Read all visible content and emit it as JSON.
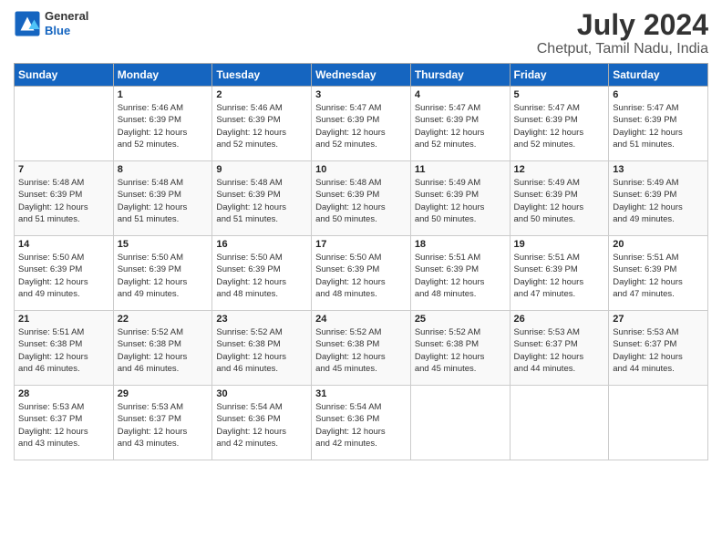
{
  "logo": {
    "line1": "General",
    "line2": "Blue"
  },
  "title": "July 2024",
  "subtitle": "Chetput, Tamil Nadu, India",
  "days_header": [
    "Sunday",
    "Monday",
    "Tuesday",
    "Wednesday",
    "Thursday",
    "Friday",
    "Saturday"
  ],
  "weeks": [
    [
      {
        "day": "",
        "info": ""
      },
      {
        "day": "1",
        "info": "Sunrise: 5:46 AM\nSunset: 6:39 PM\nDaylight: 12 hours\nand 52 minutes."
      },
      {
        "day": "2",
        "info": "Sunrise: 5:46 AM\nSunset: 6:39 PM\nDaylight: 12 hours\nand 52 minutes."
      },
      {
        "day": "3",
        "info": "Sunrise: 5:47 AM\nSunset: 6:39 PM\nDaylight: 12 hours\nand 52 minutes."
      },
      {
        "day": "4",
        "info": "Sunrise: 5:47 AM\nSunset: 6:39 PM\nDaylight: 12 hours\nand 52 minutes."
      },
      {
        "day": "5",
        "info": "Sunrise: 5:47 AM\nSunset: 6:39 PM\nDaylight: 12 hours\nand 52 minutes."
      },
      {
        "day": "6",
        "info": "Sunrise: 5:47 AM\nSunset: 6:39 PM\nDaylight: 12 hours\nand 51 minutes."
      }
    ],
    [
      {
        "day": "7",
        "info": "Sunrise: 5:48 AM\nSunset: 6:39 PM\nDaylight: 12 hours\nand 51 minutes."
      },
      {
        "day": "8",
        "info": "Sunrise: 5:48 AM\nSunset: 6:39 PM\nDaylight: 12 hours\nand 51 minutes."
      },
      {
        "day": "9",
        "info": "Sunrise: 5:48 AM\nSunset: 6:39 PM\nDaylight: 12 hours\nand 51 minutes."
      },
      {
        "day": "10",
        "info": "Sunrise: 5:48 AM\nSunset: 6:39 PM\nDaylight: 12 hours\nand 50 minutes."
      },
      {
        "day": "11",
        "info": "Sunrise: 5:49 AM\nSunset: 6:39 PM\nDaylight: 12 hours\nand 50 minutes."
      },
      {
        "day": "12",
        "info": "Sunrise: 5:49 AM\nSunset: 6:39 PM\nDaylight: 12 hours\nand 50 minutes."
      },
      {
        "day": "13",
        "info": "Sunrise: 5:49 AM\nSunset: 6:39 PM\nDaylight: 12 hours\nand 49 minutes."
      }
    ],
    [
      {
        "day": "14",
        "info": "Sunrise: 5:50 AM\nSunset: 6:39 PM\nDaylight: 12 hours\nand 49 minutes."
      },
      {
        "day": "15",
        "info": "Sunrise: 5:50 AM\nSunset: 6:39 PM\nDaylight: 12 hours\nand 49 minutes."
      },
      {
        "day": "16",
        "info": "Sunrise: 5:50 AM\nSunset: 6:39 PM\nDaylight: 12 hours\nand 48 minutes."
      },
      {
        "day": "17",
        "info": "Sunrise: 5:50 AM\nSunset: 6:39 PM\nDaylight: 12 hours\nand 48 minutes."
      },
      {
        "day": "18",
        "info": "Sunrise: 5:51 AM\nSunset: 6:39 PM\nDaylight: 12 hours\nand 48 minutes."
      },
      {
        "day": "19",
        "info": "Sunrise: 5:51 AM\nSunset: 6:39 PM\nDaylight: 12 hours\nand 47 minutes."
      },
      {
        "day": "20",
        "info": "Sunrise: 5:51 AM\nSunset: 6:39 PM\nDaylight: 12 hours\nand 47 minutes."
      }
    ],
    [
      {
        "day": "21",
        "info": "Sunrise: 5:51 AM\nSunset: 6:38 PM\nDaylight: 12 hours\nand 46 minutes."
      },
      {
        "day": "22",
        "info": "Sunrise: 5:52 AM\nSunset: 6:38 PM\nDaylight: 12 hours\nand 46 minutes."
      },
      {
        "day": "23",
        "info": "Sunrise: 5:52 AM\nSunset: 6:38 PM\nDaylight: 12 hours\nand 46 minutes."
      },
      {
        "day": "24",
        "info": "Sunrise: 5:52 AM\nSunset: 6:38 PM\nDaylight: 12 hours\nand 45 minutes."
      },
      {
        "day": "25",
        "info": "Sunrise: 5:52 AM\nSunset: 6:38 PM\nDaylight: 12 hours\nand 45 minutes."
      },
      {
        "day": "26",
        "info": "Sunrise: 5:53 AM\nSunset: 6:37 PM\nDaylight: 12 hours\nand 44 minutes."
      },
      {
        "day": "27",
        "info": "Sunrise: 5:53 AM\nSunset: 6:37 PM\nDaylight: 12 hours\nand 44 minutes."
      }
    ],
    [
      {
        "day": "28",
        "info": "Sunrise: 5:53 AM\nSunset: 6:37 PM\nDaylight: 12 hours\nand 43 minutes."
      },
      {
        "day": "29",
        "info": "Sunrise: 5:53 AM\nSunset: 6:37 PM\nDaylight: 12 hours\nand 43 minutes."
      },
      {
        "day": "30",
        "info": "Sunrise: 5:54 AM\nSunset: 6:36 PM\nDaylight: 12 hours\nand 42 minutes."
      },
      {
        "day": "31",
        "info": "Sunrise: 5:54 AM\nSunset: 6:36 PM\nDaylight: 12 hours\nand 42 minutes."
      },
      {
        "day": "",
        "info": ""
      },
      {
        "day": "",
        "info": ""
      },
      {
        "day": "",
        "info": ""
      }
    ]
  ]
}
